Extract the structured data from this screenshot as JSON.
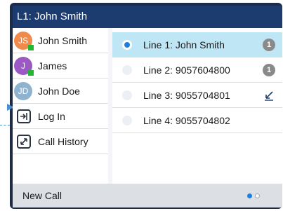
{
  "header": {
    "title": "L1: John Smith"
  },
  "contacts": [
    {
      "name": "John Smith",
      "initials": "JS",
      "color": "#f08a4b",
      "online": true
    },
    {
      "name": "James",
      "initials": "J",
      "color": "#9b59c4",
      "online": true
    },
    {
      "name": "John Doe",
      "initials": "JD",
      "color": "#8fb3cf",
      "online": false
    }
  ],
  "actions": [
    {
      "label": "Log In",
      "icon": "login-icon"
    },
    {
      "label": "Call History",
      "icon": "call-history-icon"
    }
  ],
  "lines": [
    {
      "label": "Line 1: John Smith",
      "selected": true,
      "badge": "1"
    },
    {
      "label": "Line 2: 9057604800",
      "selected": false,
      "badge": "1"
    },
    {
      "label": "Line 3: 9055704801",
      "selected": false,
      "status_icon": "missed-call-icon"
    },
    {
      "label": "Line 4: 9055704802",
      "selected": false
    }
  ],
  "footer": {
    "softkey_label": "New Call",
    "pages": 2,
    "current_page": 1
  },
  "colors": {
    "header_bg": "#1c3b6e",
    "selected_row": "#bfe6f5",
    "accent": "#1e7fd8",
    "presence": "#1fb830"
  }
}
